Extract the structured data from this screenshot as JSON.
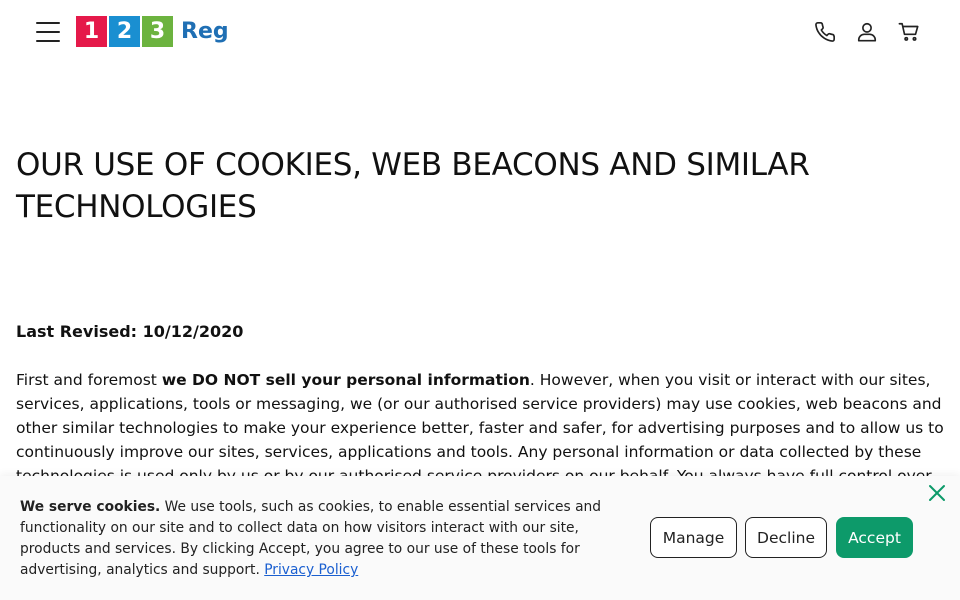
{
  "header": {
    "logo": {
      "digits": [
        "1",
        "2",
        "3"
      ],
      "text": "Reg",
      "colors": [
        "#e5194a",
        "#1a8fd1",
        "#6cb33f"
      ],
      "text_color": "#1f6fb4"
    }
  },
  "article": {
    "title": "OUR USE OF COOKIES, WEB BEACONS AND SIMILAR TECHNOLOGIES",
    "revised": "Last Revised: 10/12/2020",
    "para_intro": "First and foremost ",
    "para_bold": "we DO NOT sell your personal information",
    "para_rest": ". However, when you visit or interact with our sites, services, applications, tools or messaging, we (or our authorised service providers) may use cookies, web beacons and other similar technologies to make your experience better, faster and safer, for advertising purposes and to allow us to continuously improve our sites, services, applications and tools. Any personal information or data collected by these technologies is used only by us or by our authorised service providers on our behalf. You always have full control over"
  },
  "cookie_banner": {
    "lead": "We serve cookies.",
    "text": " We use tools, such as cookies, to enable essential services and functionality on our site and to collect data on how visitors interact with our site, products and services. By clicking Accept, you agree to our use of these tools for advertising, analytics and support. ",
    "link": "Privacy Policy",
    "manage_label": "Manage",
    "decline_label": "Decline",
    "accept_label": "Accept",
    "accent": "#0d9a6a"
  }
}
